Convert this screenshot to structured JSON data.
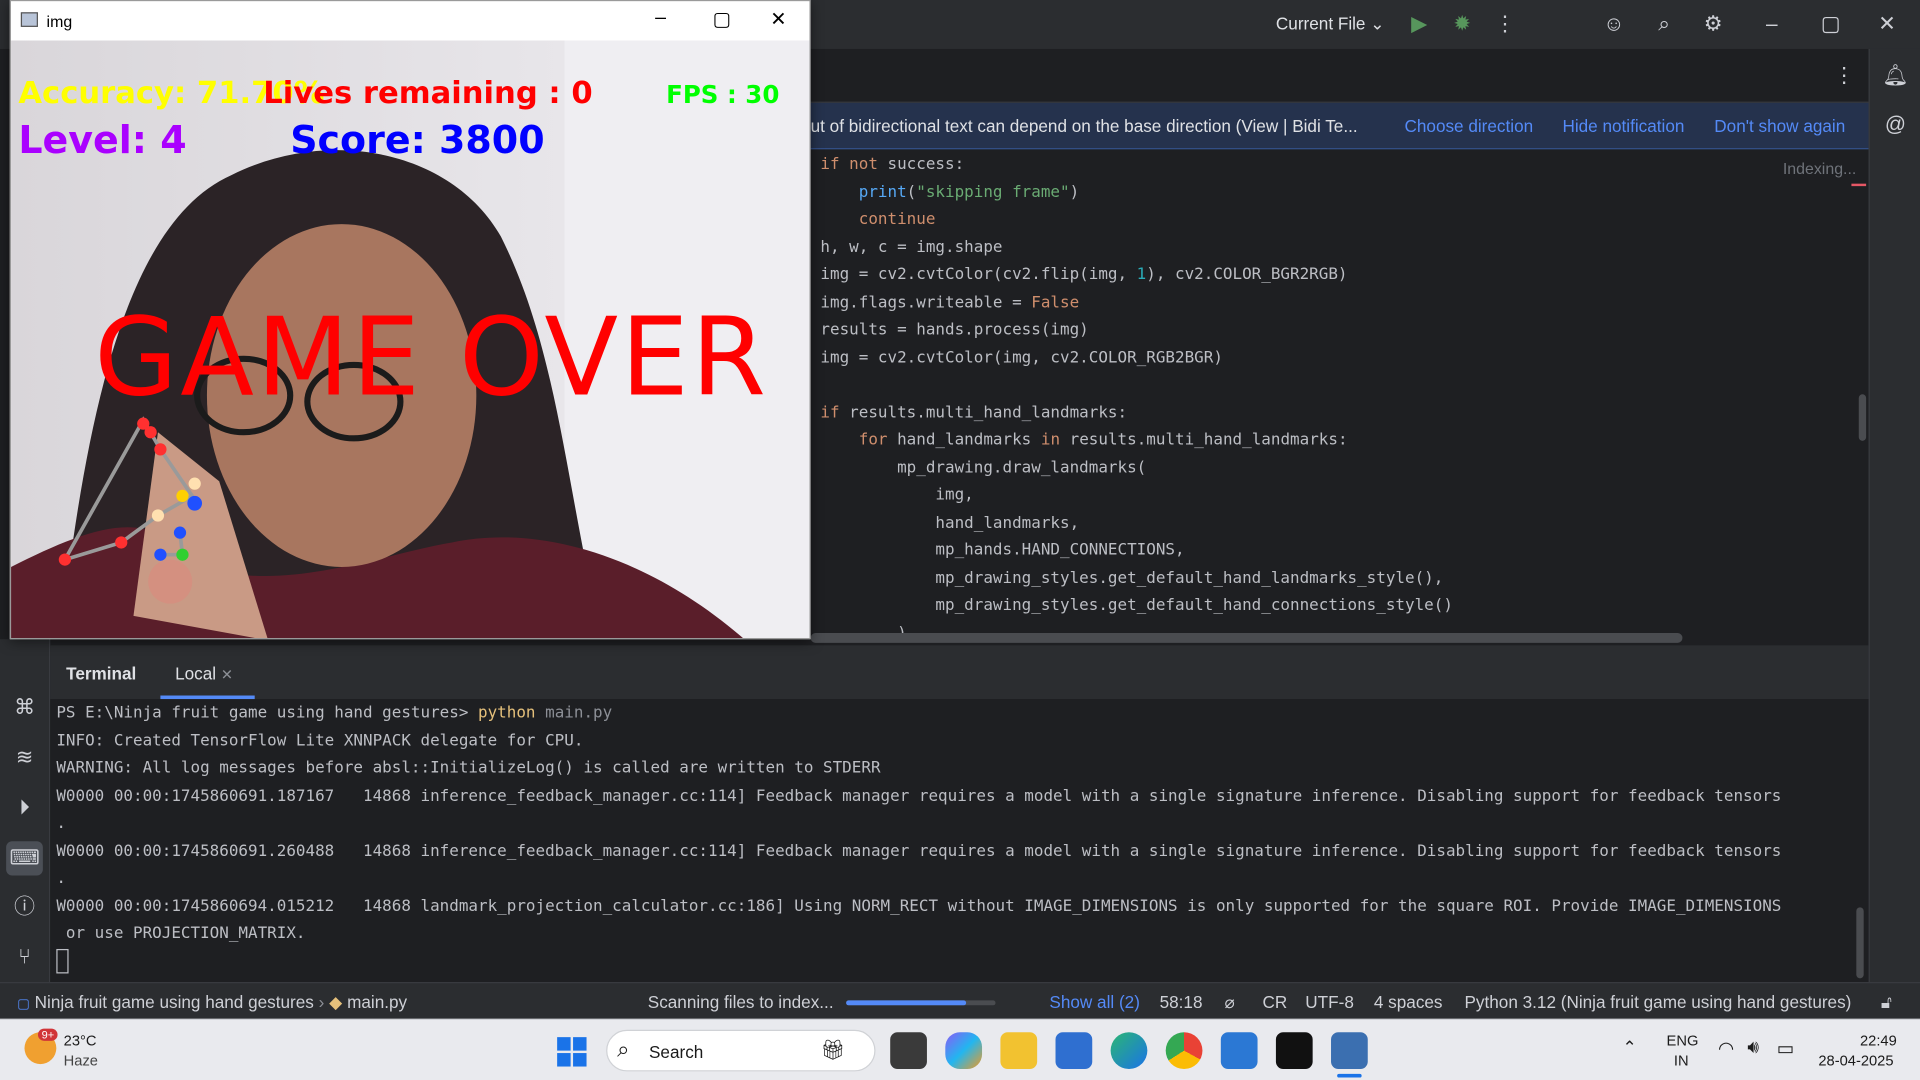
{
  "ide": {
    "run_config": "Current File",
    "notification": {
      "text": "ut of bidirectional text can depend on the base direction (View | Bidi Te...",
      "actions": [
        "Choose direction",
        "Hide notification",
        "Don't show again"
      ]
    },
    "indexing": "Indexing...",
    "code_lines": [
      "if not success:",
      "    print(\"skipping frame\")",
      "    continue",
      "h, w, c = img.shape",
      "img = cv2.cvtColor(cv2.flip(img, 1), cv2.COLOR_BGR2RGB)",
      "img.flags.writeable = False",
      "results = hands.process(img)",
      "img = cv2.cvtColor(img, cv2.COLOR_RGB2BGR)",
      "",
      "if results.multi_hand_landmarks:",
      "    for hand_landmarks in results.multi_hand_landmarks:",
      "        mp_drawing.draw_landmarks(",
      "            img,",
      "            hand_landmarks,",
      "            mp_hands.HAND_CONNECTIONS,",
      "            mp_drawing_styles.get_default_hand_landmarks_style(),",
      "            mp_drawing_styles.get_default_hand_connections_style()",
      "        )"
    ]
  },
  "terminal": {
    "tabs": [
      "Terminal",
      "Local"
    ],
    "prompt": "PS E:\\Ninja fruit game using hand gestures>",
    "command": "python",
    "argument": "main.py",
    "lines": [
      "INFO: Created TensorFlow Lite XNNPACK delegate for CPU.",
      "WARNING: All log messages before absl::InitializeLog() is called are written to STDERR",
      "W0000 00:00:1745860691.187167   14868 inference_feedback_manager.cc:114] Feedback manager requires a model with a single signature inference. Disabling support for feedback tensors",
      ".",
      "W0000 00:00:1745860691.260488   14868 inference_feedback_manager.cc:114] Feedback manager requires a model with a single signature inference. Disabling support for feedback tensors",
      ".",
      "W0000 00:00:1745860694.015212   14868 landmark_projection_calculator.cc:186] Using NORM_RECT without IMAGE_DIMENSIONS is only supported for the square ROI. Provide IMAGE_DIMENSIONS",
      " or use PROJECTION_MATRIX."
    ]
  },
  "status": {
    "project": "Ninja fruit game using hand gestures",
    "file": "main.py",
    "scanning": "Scanning files to index...",
    "scan_progress": 0.8,
    "show_all": "Show all (2)",
    "position": "58:18",
    "line_sep": "CR",
    "encoding": "UTF-8",
    "indent": "4 spaces",
    "interpreter": "Python 3.12 (Ninja fruit game using hand gestures)"
  },
  "cv_window": {
    "title": "img",
    "hud": {
      "accuracy": "Accuracy: 71.70%",
      "lives": "Lives remaining : 0",
      "fps": "FPS : 30",
      "level": "Level: 4",
      "score": "Score: 3800",
      "game_over": "GAME OVER"
    },
    "colors": {
      "accuracy": "#ffff00",
      "lives": "#ff0000",
      "fps": "#00ff00",
      "level": "#aa00ff",
      "score": "#0000ff",
      "game_over": "#ff0000"
    }
  },
  "taskbar": {
    "weather_temp": "23°C",
    "weather_desc": "Haze",
    "weather_badge": "9+",
    "search": "Search",
    "lang": "ENG",
    "region": "IN",
    "time": "22:49",
    "date": "28-04-2025"
  }
}
